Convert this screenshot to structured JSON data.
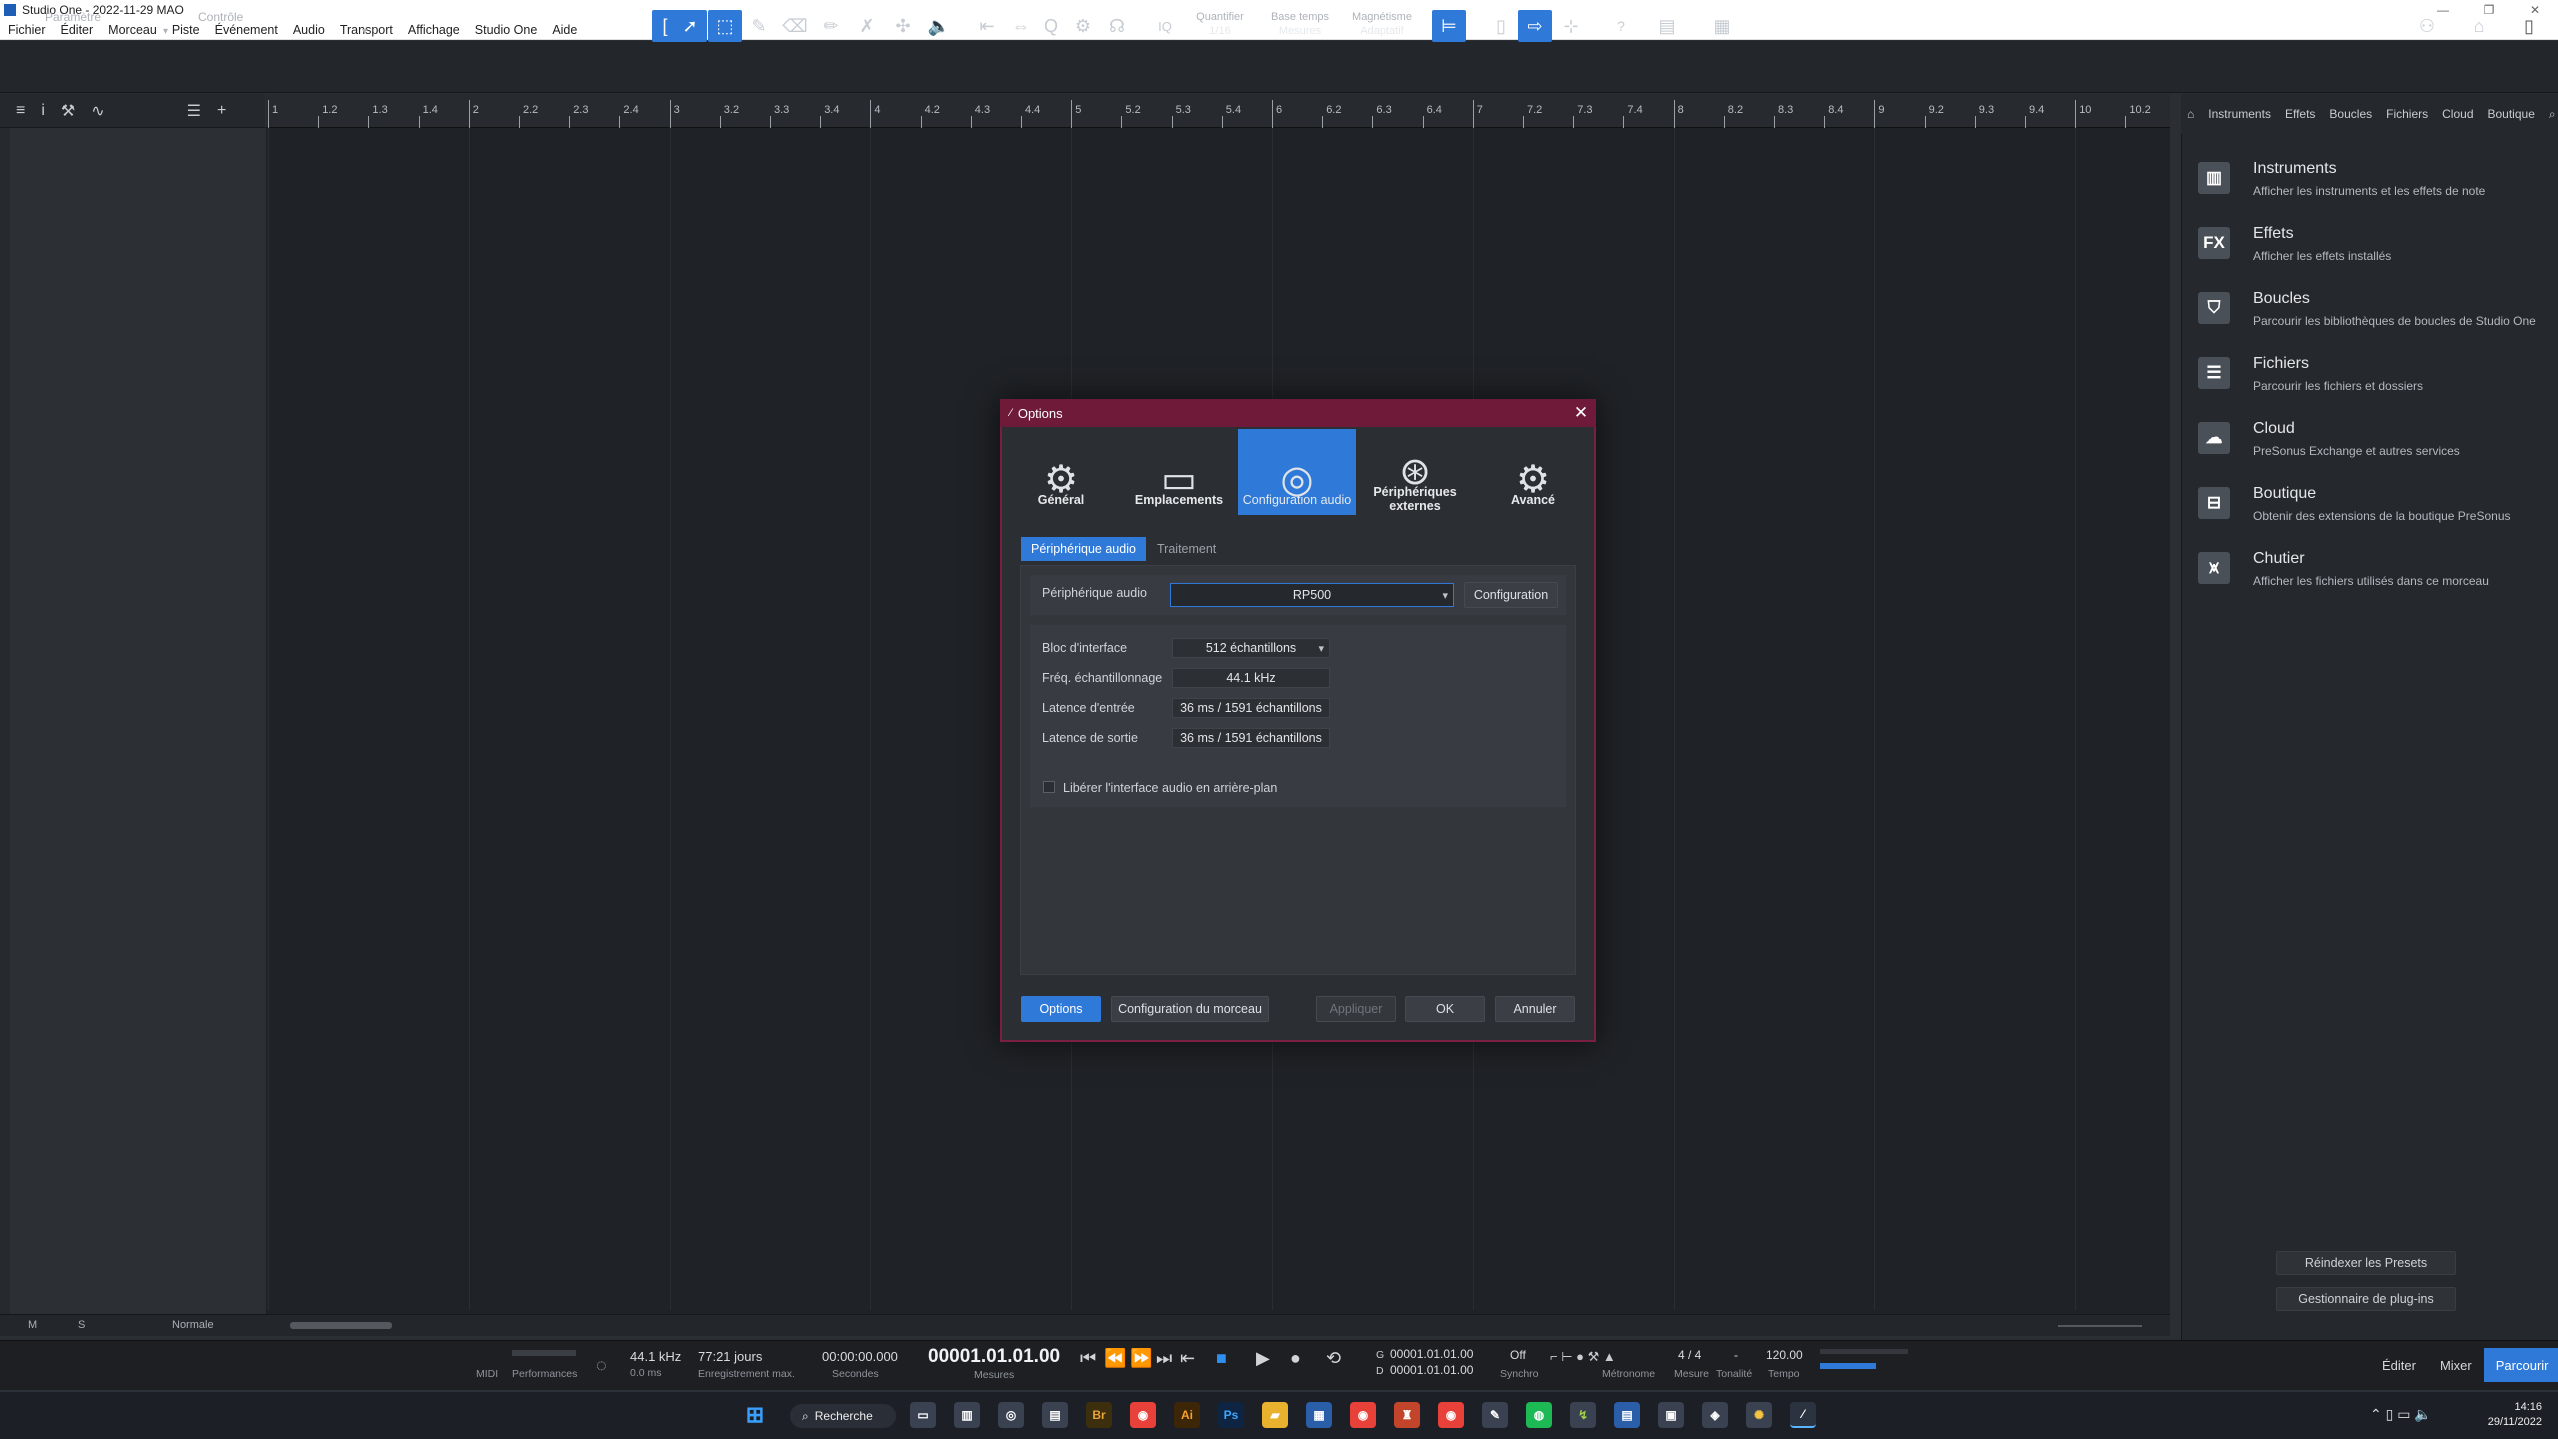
{
  "window": {
    "title": "Studio One - 2022-11-29 MAO",
    "controls": [
      "—",
      "❐",
      "✕"
    ]
  },
  "menu": [
    "Fichier",
    "Éditer",
    "Morceau",
    "Piste",
    "Événement",
    "Audio",
    "Transport",
    "Affichage",
    "Studio One",
    "Aide"
  ],
  "toolbar": {
    "param_label": "Paramètre",
    "control_label": "Contrôle",
    "iq": "IQ",
    "quantize_label": "Quantifier",
    "quantize_value": "1/16",
    "timebase_label": "Base temps",
    "timebase_value": "Mesures",
    "snap_label": "Magnétisme",
    "snap_value": "Adaptatif",
    "help": "?"
  },
  "ruler": {
    "labels": [
      "1",
      "1.2",
      "1.3",
      "1.4",
      "2",
      "2.2",
      "2.3",
      "2.4",
      "3",
      "3.2",
      "3.3",
      "3.4",
      "4",
      "4.2",
      "4.3",
      "4.4",
      "5",
      "5.2",
      "5.3",
      "5.4",
      "6",
      "6.2",
      "6.3",
      "6.4",
      "7",
      "7.2",
      "7.3",
      "7.4",
      "8",
      "8.2",
      "8.3",
      "8.4",
      "9",
      "9.2",
      "9.3",
      "9.4",
      "10",
      "10.2"
    ]
  },
  "trackbar": {
    "m": "M",
    "s": "S",
    "mode": "Normale"
  },
  "browser": {
    "tabs": [
      "Instruments",
      "Effets",
      "Boucles",
      "Fichiers",
      "Cloud",
      "Boutique"
    ],
    "items": [
      {
        "title": "Instruments",
        "desc": "Afficher les instruments et les effets de note",
        "icon": "▥"
      },
      {
        "title": "Effets",
        "desc": "Afficher les effets installés",
        "icon": "FX"
      },
      {
        "title": "Boucles",
        "desc": "Parcourir les bibliothèques de boucles de Studio One",
        "icon": "⛉"
      },
      {
        "title": "Fichiers",
        "desc": "Parcourir les fichiers et dossiers",
        "icon": "☰"
      },
      {
        "title": "Cloud",
        "desc": "PreSonus Exchange et autres services",
        "icon": "☁"
      },
      {
        "title": "Boutique",
        "desc": "Obtenir des extensions de la boutique PreSonus",
        "icon": "⊟"
      },
      {
        "title": "Chutier",
        "desc": "Afficher les fichiers utilisés dans ce morceau",
        "icon": "⩙"
      }
    ],
    "reindex": "Réindexer les Presets",
    "plugin_manager": "Gestionnaire de plug-ins"
  },
  "transport": {
    "midi": "MIDI",
    "performance": "Performances",
    "samplerate": "44.1 kHz",
    "latency": "0.0 ms",
    "record_time": "77:21 jours",
    "record_label": "Enregistrement max.",
    "seconds_value": "00:00:00.000",
    "seconds_label": "Secondes",
    "position": "00001.01.01.00",
    "position_label": "Mesures",
    "loop_start": "00001.01.01.00",
    "loop_end": "00001.01.01.00",
    "loop_l": "G",
    "loop_r": "D",
    "sync_value": "Off",
    "sync_label": "Synchro",
    "metronome_label": "Métronome",
    "time_sig": "4 / 4",
    "time_sig_label": "Mesure",
    "key_value": "-",
    "key_label": "Tonalité",
    "tempo": "120.00",
    "tempo_label": "Tempo",
    "views": [
      "Éditer",
      "Mixer",
      "Parcourir"
    ]
  },
  "taskbar": {
    "search": "Recherche",
    "time": "14:16",
    "date": "29/11/2022"
  },
  "dialog": {
    "title": "Options",
    "tabs": [
      {
        "label": "Général",
        "icon": "⚙"
      },
      {
        "label": "Emplacements",
        "icon": "▭"
      },
      {
        "label": "Configuration audio",
        "icon": "◎"
      },
      {
        "label": "Périphériques externes",
        "icon": "⊛"
      },
      {
        "label": "Avancé",
        "icon": "⚙"
      }
    ],
    "subtabs": [
      "Périphérique audio",
      "Traitement"
    ],
    "device_label": "Périphérique audio",
    "device_value": "RP500",
    "config_button": "Configuration",
    "block_label": "Bloc d'interface",
    "block_value": "512 échantillons",
    "rate_label": "Fréq. échantillonnage",
    "rate_value": "44.1 kHz",
    "in_lat_label": "Latence d'entrée",
    "in_lat_value": "36 ms / 1591 échantillons",
    "out_lat_label": "Latence de sortie",
    "out_lat_value": "36 ms / 1591 échantillons",
    "release_label": "Libérer l'interface audio en arrière-plan",
    "buttons": {
      "options": "Options",
      "song_config": "Configuration du morceau",
      "apply": "Appliquer",
      "ok": "OK",
      "cancel": "Annuler"
    }
  }
}
